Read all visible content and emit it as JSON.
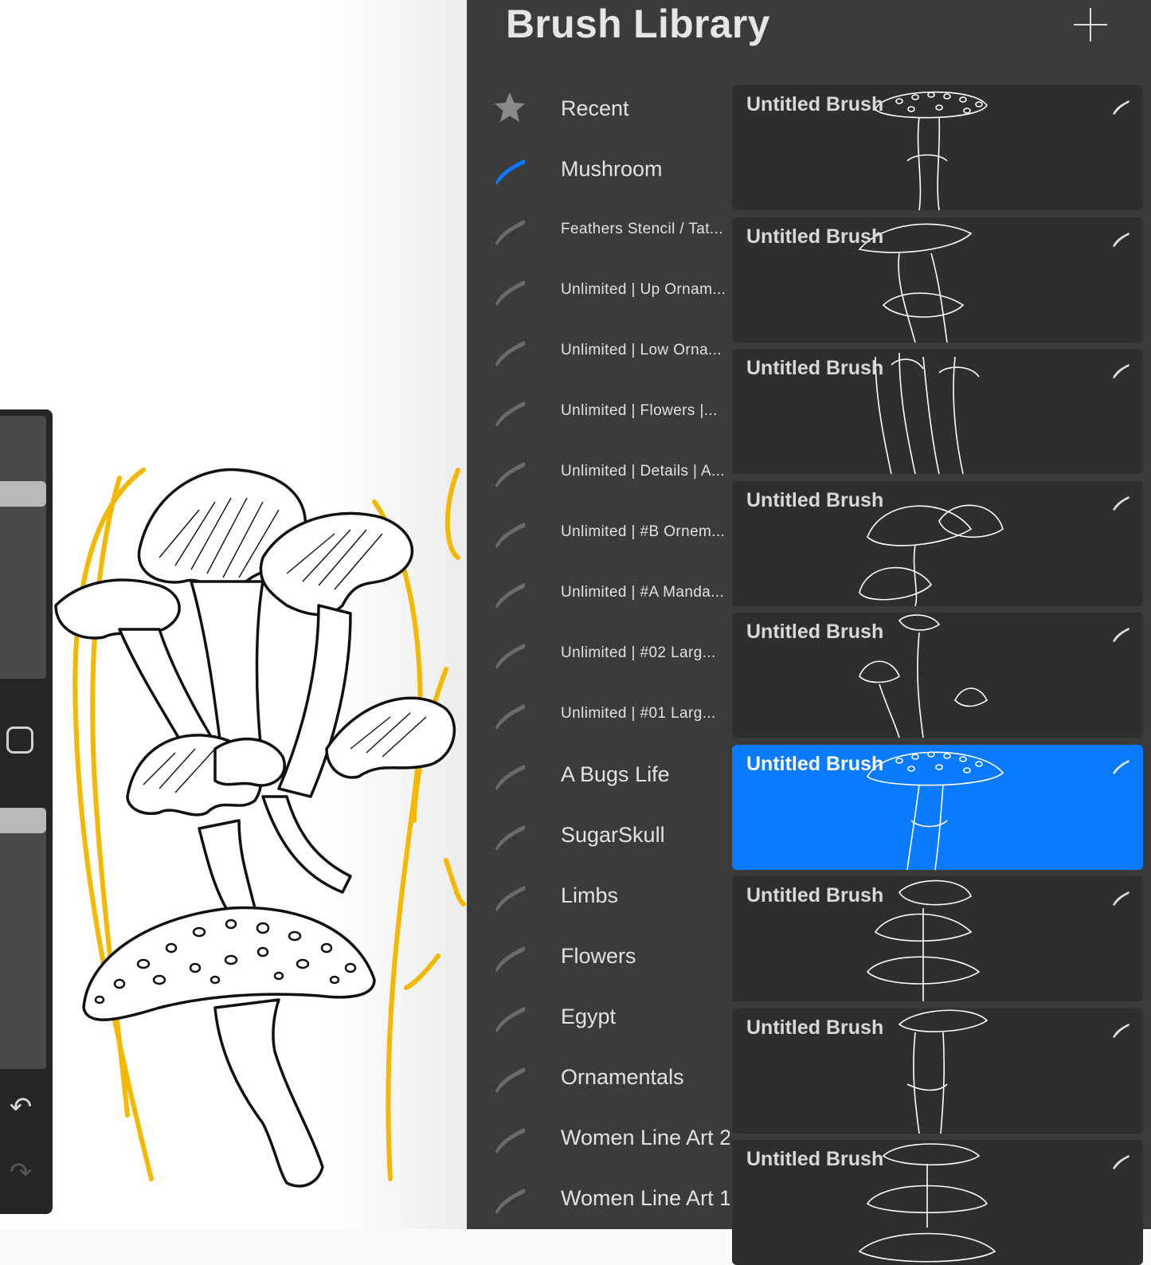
{
  "panel": {
    "title": "Brush Library",
    "add_button": "plus-icon"
  },
  "brush_sets": [
    {
      "label": "Recent",
      "icon": "star-icon",
      "size": "big",
      "selected": false
    },
    {
      "label": "Mushroom",
      "icon": "brush-stroke-icon",
      "size": "big",
      "selected": true
    },
    {
      "label": "Feathers Stencil / Tat...",
      "icon": "brush-stroke-icon",
      "size": "small",
      "selected": false
    },
    {
      "label": "Unlimited | Up Ornam...",
      "icon": "brush-stroke-icon",
      "size": "small",
      "selected": false
    },
    {
      "label": "Unlimited | Low Orna...",
      "icon": "brush-stroke-icon",
      "size": "small",
      "selected": false
    },
    {
      "label": "Unlimited | Flowers |...",
      "icon": "brush-stroke-icon",
      "size": "small",
      "selected": false
    },
    {
      "label": "Unlimited | Details | A...",
      "icon": "brush-stroke-icon",
      "size": "small",
      "selected": false
    },
    {
      "label": "Unlimited | #B Ornem...",
      "icon": "brush-stroke-icon",
      "size": "small",
      "selected": false
    },
    {
      "label": "Unlimited | #A Manda...",
      "icon": "brush-stroke-icon",
      "size": "small",
      "selected": false
    },
    {
      "label": "Unlimited | #02 Larg...",
      "icon": "brush-stroke-icon",
      "size": "small",
      "selected": false
    },
    {
      "label": "Unlimited | #01 Larg...",
      "icon": "brush-stroke-icon",
      "size": "small",
      "selected": false
    },
    {
      "label": "A Bugs Life",
      "icon": "brush-stroke-icon",
      "size": "big",
      "selected": false
    },
    {
      "label": "SugarSkull",
      "icon": "brush-stroke-icon",
      "size": "big",
      "selected": false
    },
    {
      "label": "Limbs",
      "icon": "brush-stroke-icon",
      "size": "big",
      "selected": false
    },
    {
      "label": "Flowers",
      "icon": "brush-stroke-icon",
      "size": "big",
      "selected": false
    },
    {
      "label": "Egypt",
      "icon": "brush-stroke-icon",
      "size": "big",
      "selected": false
    },
    {
      "label": "Ornamentals",
      "icon": "brush-stroke-icon",
      "size": "big",
      "selected": false
    },
    {
      "label": "Women Line Art 2",
      "icon": "brush-stroke-icon",
      "size": "big",
      "selected": false
    },
    {
      "label": "Women Line Art 1",
      "icon": "brush-stroke-icon",
      "size": "big",
      "selected": false
    }
  ],
  "brushes": [
    {
      "name": "Untitled Brush",
      "selected": false,
      "preview": "fly-agaric-mushroom-stamp"
    },
    {
      "name": "Untitled Brush",
      "selected": false,
      "preview": "oyster-mushroom-cluster-stamp"
    },
    {
      "name": "Untitled Brush",
      "selected": false,
      "preview": "enoki-mushroom-cluster-stamp"
    },
    {
      "name": "Untitled Brush",
      "selected": false,
      "preview": "toadstool-group-stamp"
    },
    {
      "name": "Untitled Brush",
      "selected": false,
      "preview": "tall-mushrooms-stamp"
    },
    {
      "name": "Untitled Brush",
      "selected": true,
      "preview": "spotted-mushroom-stamp"
    },
    {
      "name": "Untitled Brush",
      "selected": false,
      "preview": "mushroom-stack-stamp"
    },
    {
      "name": "Untitled Brush",
      "selected": false,
      "preview": "mushroom-stem-stamp"
    },
    {
      "name": "Untitled Brush",
      "selected": false,
      "preview": "oyster-mushroom-stamp"
    }
  ],
  "sidebar": {
    "undo_icon": "undo-icon",
    "redo_icon": "redo-icon",
    "modify_icon": "square-modify-icon"
  },
  "colors": {
    "panel_bg": "#3b3b3b",
    "card_bg": "#2e2e2e",
    "accent": "#0a7aff",
    "sketch_yellow": "#f5b800"
  }
}
